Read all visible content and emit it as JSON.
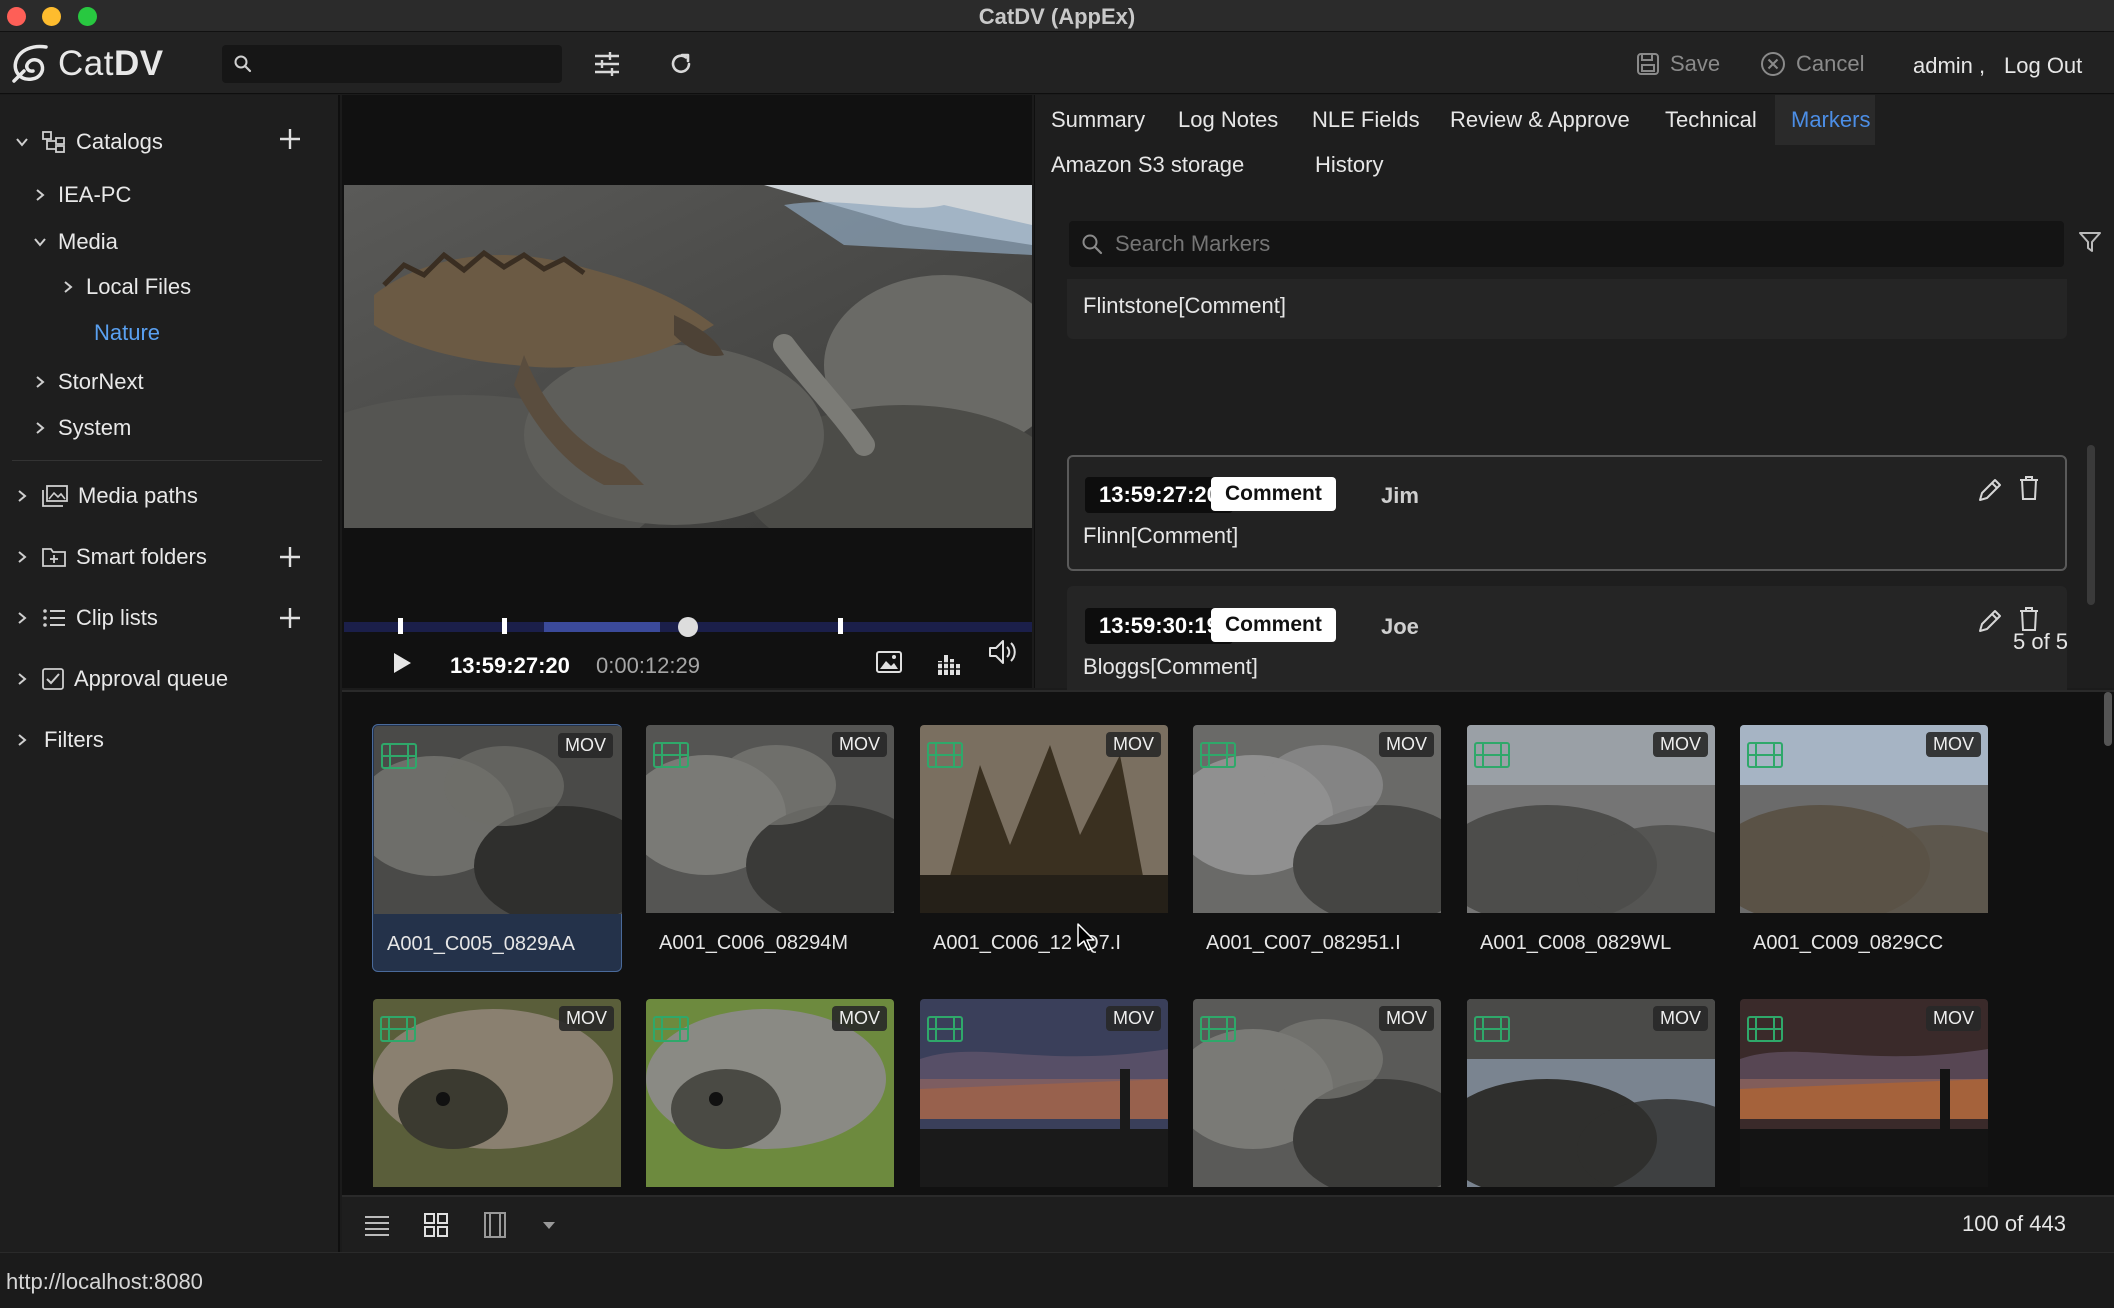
{
  "window": {
    "title": "CatDV (AppEx)"
  },
  "toolbar": {
    "logo_text_light": "Cat",
    "logo_text_bold": "DV",
    "search_value": "",
    "save_label": "Save",
    "cancel_label": "Cancel",
    "user_name": "admin ,",
    "logout_label": "Log Out"
  },
  "sidebar": {
    "catalogs_label": "Catalogs",
    "tree": {
      "iea_pc": "IEA-PC",
      "media": "Media",
      "local_files": "Local Files",
      "nature": "Nature",
      "stornext": "StorNext",
      "system": "System"
    },
    "media_paths": "Media paths",
    "smart_folders": "Smart folders",
    "clip_lists": "Clip lists",
    "approval_queue": "Approval queue",
    "filters": "Filters"
  },
  "player": {
    "timecode": "13:59:27:20",
    "duration": "0:00:12:29"
  },
  "tabs": [
    "Summary",
    "Log Notes",
    "NLE Fields",
    "Review & Approve",
    "Technical",
    "Markers",
    "Amazon S3 storage",
    "History"
  ],
  "active_tab": "Markers",
  "markers": {
    "search_placeholder": "Search Markers",
    "partial_text": "Flintstone[Comment]",
    "items": [
      {
        "timecode": "13:59:27:20",
        "type": "Comment",
        "user": "Jim",
        "text": "Flinn[Comment]"
      },
      {
        "timecode": "13:59:30:19",
        "type": "Comment",
        "user": "Joe",
        "text": "Bloggs[Comment]"
      }
    ],
    "count": "5 of 5"
  },
  "clips": {
    "badge": "MOV",
    "row1": [
      "A001_C005_0829AA",
      "A001_C006_08294M",
      "A001_C006_12  Q7.I",
      "A001_C007_082951.I",
      "A001_C008_0829WL",
      "A001_C009_0829CC"
    ],
    "count": "100 of 443"
  },
  "status": {
    "url": "http://localhost:8080"
  },
  "colors": {
    "accent": "#4c8ee6",
    "clip_icon": "#2fa86a",
    "background": "#1b1b1b"
  }
}
